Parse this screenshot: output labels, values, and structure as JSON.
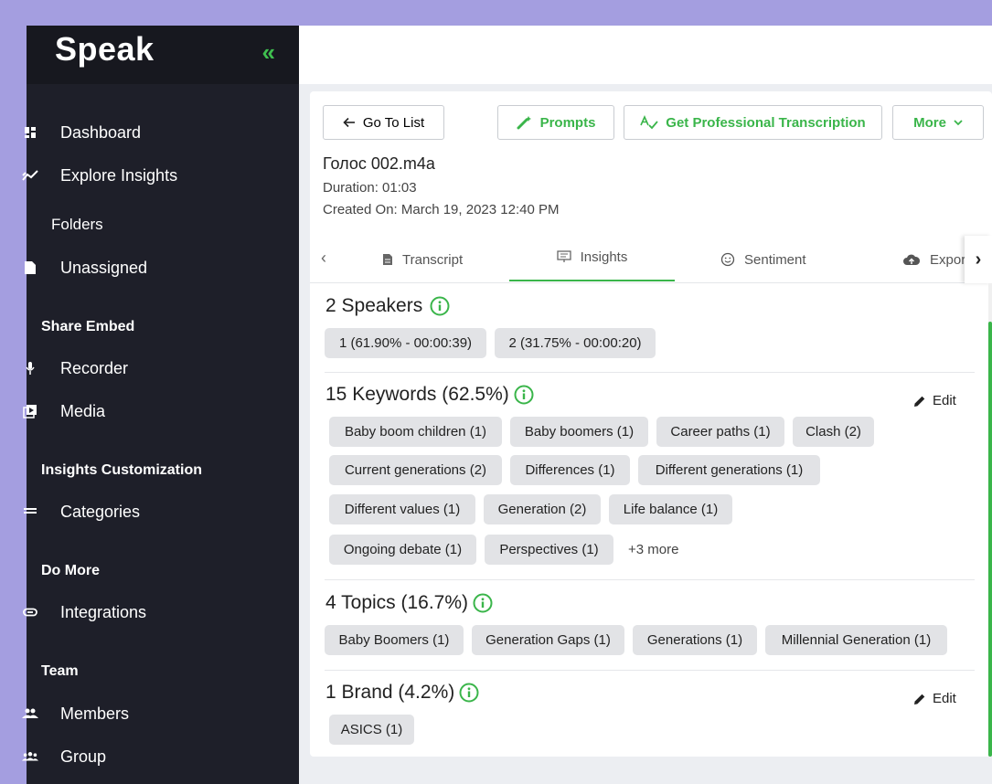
{
  "app": {
    "logo": "Speak"
  },
  "sidebar": {
    "items": [
      {
        "label": "Dashboard",
        "icon": "dashboard-icon"
      },
      {
        "label": "Explore Insights",
        "icon": "insights-icon"
      },
      {
        "label": "Unassigned",
        "icon": "file-icon"
      },
      {
        "label": "Recorder",
        "icon": "microphone-icon"
      },
      {
        "label": "Media",
        "icon": "media-icon"
      },
      {
        "label": "Categories",
        "icon": "list-icon"
      },
      {
        "label": "Integrations",
        "icon": "link-icon"
      },
      {
        "label": "Members",
        "icon": "members-icon"
      },
      {
        "label": "Group",
        "icon": "group-icon"
      }
    ],
    "sections": {
      "folders": "Folders",
      "share_embed": "Share Embed",
      "insights_customization": "Insights Customization",
      "do_more": "Do More",
      "team": "Team"
    }
  },
  "toolbar": {
    "go_to_list": "Go To List",
    "prompts": "Prompts",
    "professional": "Get Professional Transcription",
    "more": "More"
  },
  "file": {
    "title": "Голос 002.m4a",
    "duration": "Duration: 01:03",
    "created": "Created On: March 19, 2023 12:40 PM"
  },
  "tabs": [
    "Transcript",
    "Insights",
    "Sentiment",
    "Expor"
  ],
  "speakers": {
    "title": "2 Speakers",
    "chips": [
      "1 (61.90% - 00:00:39)",
      "2 (31.75% - 00:00:20)"
    ]
  },
  "keywords": {
    "title": "15 Keywords (62.5%)",
    "edit": "Edit",
    "chips": [
      "Baby boom children (1)",
      "Baby boomers (1)",
      "Career paths (1)",
      "Clash (2)",
      "Current generations (2)",
      "Differences (1)",
      "Different generations (1)",
      "Different values (1)",
      "Generation (2)",
      "Life balance (1)",
      "Ongoing debate (1)",
      "Perspectives (1)"
    ],
    "more": "+3 more"
  },
  "topics": {
    "title": "4 Topics (16.7%)",
    "chips": [
      "Baby Boomers (1)",
      "Generation Gaps (1)",
      "Generations (1)",
      "Millennial Generation (1)"
    ]
  },
  "brands": {
    "title": "1 Brand (4.2%)",
    "edit": "Edit",
    "chips": [
      "ASICS (1)"
    ]
  },
  "colors": {
    "accent": "#3ab54a",
    "sidebar": "#1e1f29",
    "background": "#a49ee0"
  }
}
